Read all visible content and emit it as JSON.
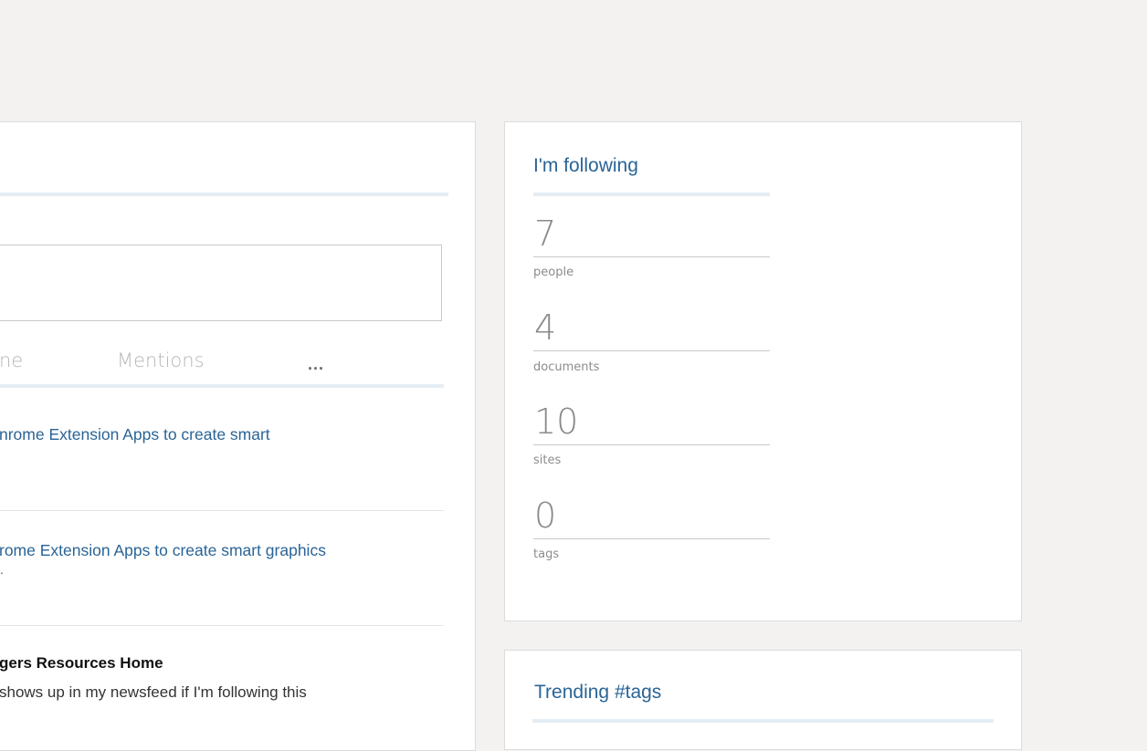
{
  "newsfeed": {
    "tabs": [
      "ne",
      "Mentions"
    ],
    "more_label": "...",
    "posts": [
      {
        "link": "nrome Extension Apps to create smart"
      },
      {
        "link": "rome Extension Apps to create smart graphics",
        "extra": "."
      },
      {
        "title": "gers Resources Home",
        "text": "shows up in my newsfeed if I'm following this"
      }
    ]
  },
  "following": {
    "title": "I'm following",
    "stats": [
      {
        "value": "7",
        "label": "people"
      },
      {
        "value": "4",
        "label": "documents"
      },
      {
        "value": "10",
        "label": "sites"
      },
      {
        "value": "0",
        "label": "tags"
      }
    ]
  },
  "trending": {
    "title": "Trending #tags"
  }
}
